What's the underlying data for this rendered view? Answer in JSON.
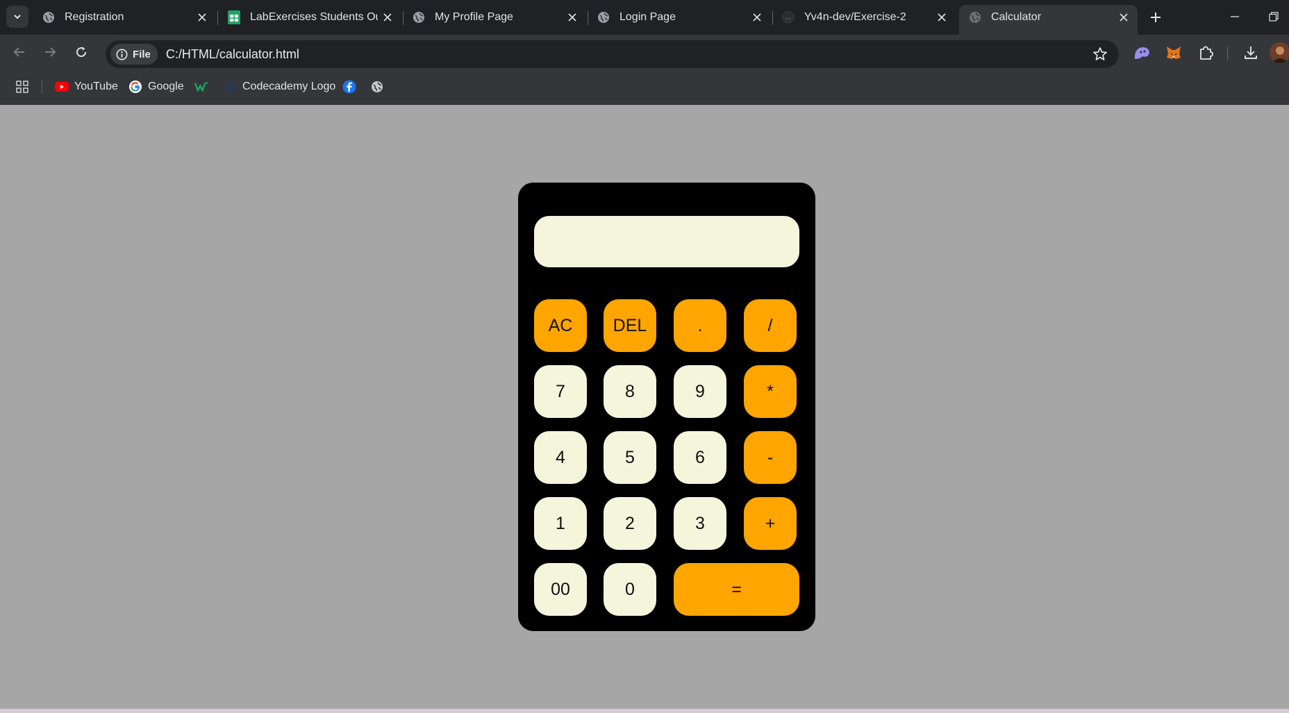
{
  "browser": {
    "tabs": [
      {
        "title": "Registration",
        "icon": "globe-icon"
      },
      {
        "title": "LabExercises Students Output",
        "icon": "sheets-icon"
      },
      {
        "title": "My Profile Page",
        "icon": "globe-icon"
      },
      {
        "title": "Login Page",
        "icon": "globe-icon"
      },
      {
        "title": "Yv4n-dev/Exercise-2",
        "icon": "github-icon"
      },
      {
        "title": "Calculator",
        "icon": "globe-icon",
        "active": true
      }
    ],
    "address": {
      "chip_label": "File",
      "url": "C:/HTML/calculator.html"
    },
    "bookmarks": [
      {
        "label": "YouTube",
        "icon": "youtube-icon"
      },
      {
        "label": "Google",
        "icon": "google-icon"
      },
      {
        "label": "",
        "icon": "w-logo-icon"
      },
      {
        "label": "Codecademy Logo",
        "icon": "codecademy-icon"
      },
      {
        "label": "",
        "icon": "facebook-icon"
      },
      {
        "label": "",
        "icon": "globe-icon"
      }
    ]
  },
  "calculator": {
    "display_value": "",
    "keys": {
      "ac": "AC",
      "del": "DEL",
      "dot": ".",
      "divide": "/",
      "seven": "7",
      "eight": "8",
      "nine": "9",
      "multiply": "*",
      "four": "4",
      "five": "5",
      "six": "6",
      "minus": "-",
      "one": "1",
      "two": "2",
      "three": "3",
      "plus": "+",
      "double_zero": "00",
      "zero": "0",
      "equals": "="
    }
  },
  "colors": {
    "page_bg": "#a6a6a6",
    "calc_bg": "#000000",
    "number_key": "#f5f5dc",
    "operator_key": "#ffa500",
    "display_bg": "#f5f5dc"
  }
}
